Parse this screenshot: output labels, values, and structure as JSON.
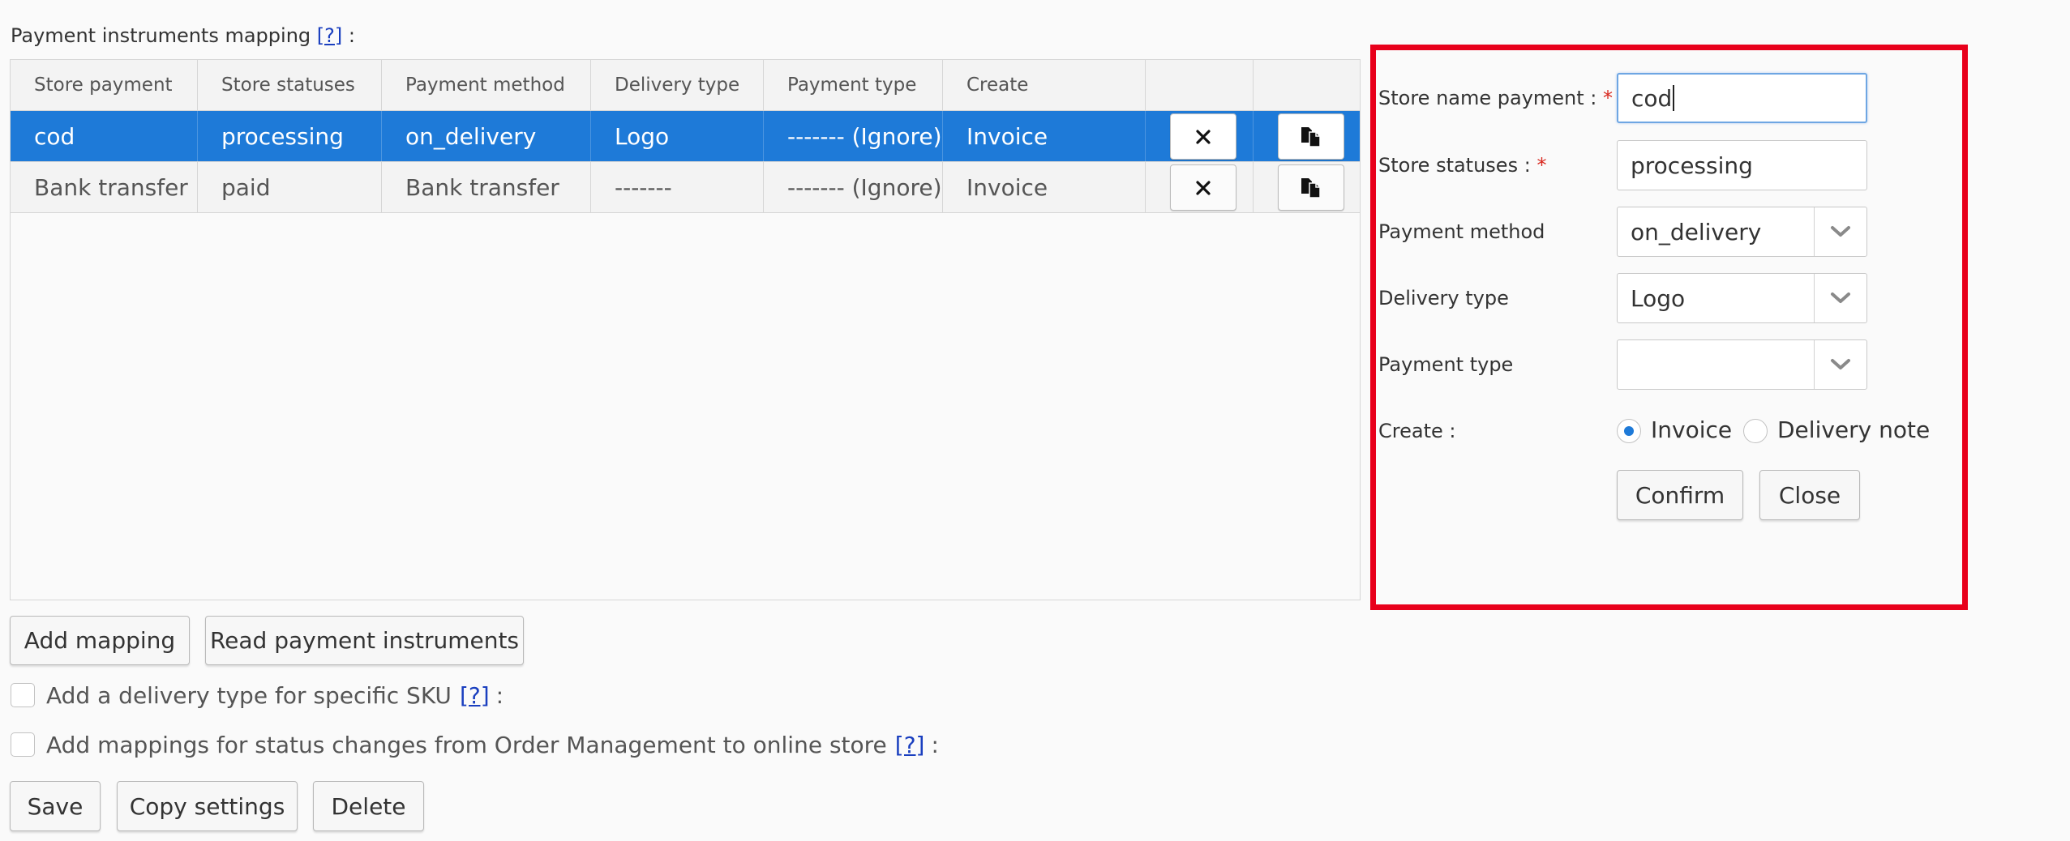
{
  "section": {
    "title": "Payment instruments mapping",
    "help": "[?]",
    "suffix": ":"
  },
  "grid": {
    "columns": [
      "Store payment",
      "Store statuses",
      "Payment method",
      "Delivery type",
      "Payment type",
      "Create"
    ],
    "rows": [
      {
        "store_payment": "cod",
        "store_statuses": "processing",
        "payment_method": "on_delivery",
        "delivery_type": "Logo",
        "payment_type": "------- (Ignore)",
        "create": "Invoice",
        "selected": true
      },
      {
        "store_payment": "Bank transfer",
        "store_statuses": "paid",
        "payment_method": "Bank transfer",
        "delivery_type": "-------",
        "payment_type": "------- (Ignore)",
        "create": "Invoice",
        "selected": false
      }
    ],
    "delete_icon": "close-icon",
    "copy_icon": "copy-icon"
  },
  "actions": {
    "add_mapping": "Add mapping",
    "read_payment_instruments": "Read payment instruments"
  },
  "options": {
    "sku_delivery": {
      "label": "Add a delivery type for specific SKU",
      "help": "[?]",
      "suffix": ":",
      "checked": false
    },
    "status_mappings": {
      "label": "Add mappings for status changes from Order Management to online store",
      "help": "[?]",
      "suffix": ":",
      "checked": false
    }
  },
  "footer": {
    "save": "Save",
    "copy_settings": "Copy settings",
    "delete": "Delete"
  },
  "form": {
    "store_name_payment": {
      "label": "Store name payment :",
      "required_mark": "*",
      "value": "cod"
    },
    "store_statuses": {
      "label": "Store statuses :",
      "required_mark": "*",
      "value": "processing"
    },
    "payment_method": {
      "label": "Payment method",
      "value": "on_delivery"
    },
    "delivery_type": {
      "label": "Delivery type",
      "value": "Logo"
    },
    "payment_type": {
      "label": "Payment type",
      "value": ""
    },
    "create": {
      "label": "Create :",
      "options": [
        "Invoice",
        "Delivery note"
      ],
      "selected": "Invoice"
    },
    "confirm": "Confirm",
    "close": "Close"
  },
  "colors": {
    "selection": "#1e7ad8",
    "highlight_border": "#e8001b",
    "required": "#d8281f",
    "link": "#1a3fbf"
  }
}
